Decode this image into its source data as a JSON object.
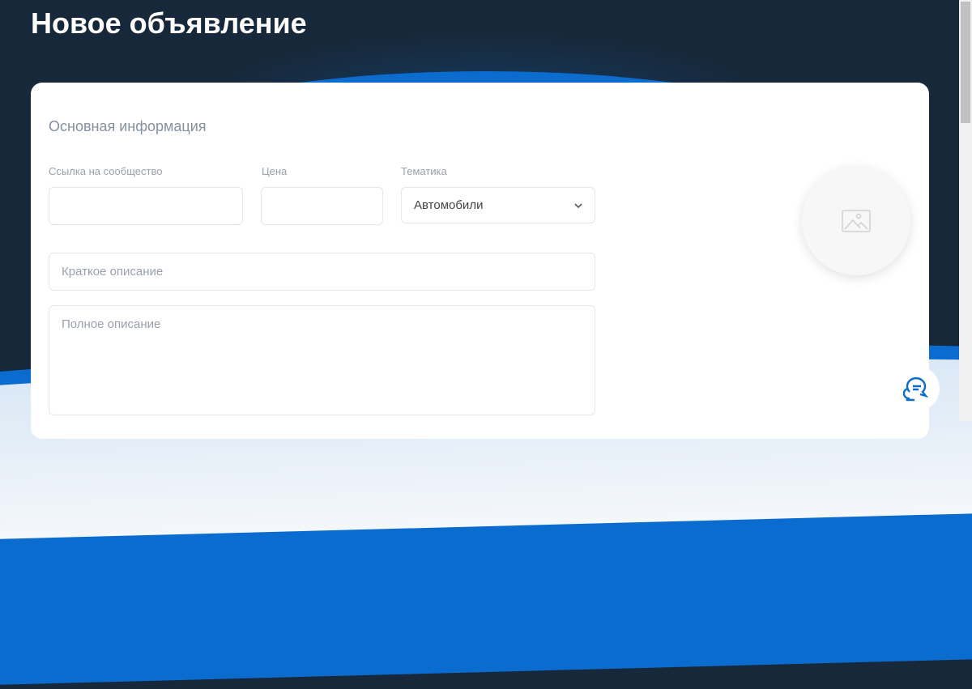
{
  "page_title": "Новое объявление",
  "section_title": "Основная информация",
  "fields": {
    "community_link": {
      "label": "Ссылка на сообщество",
      "value": ""
    },
    "price": {
      "label": "Цена",
      "value": ""
    },
    "topic": {
      "label": "Тематика",
      "value": "Автомобили"
    },
    "short_description": {
      "placeholder": "Краткое описание"
    },
    "full_description": {
      "placeholder": "Полное описание"
    }
  },
  "colors": {
    "accent": "#0a6ccf",
    "header_bg": "#17283a"
  }
}
